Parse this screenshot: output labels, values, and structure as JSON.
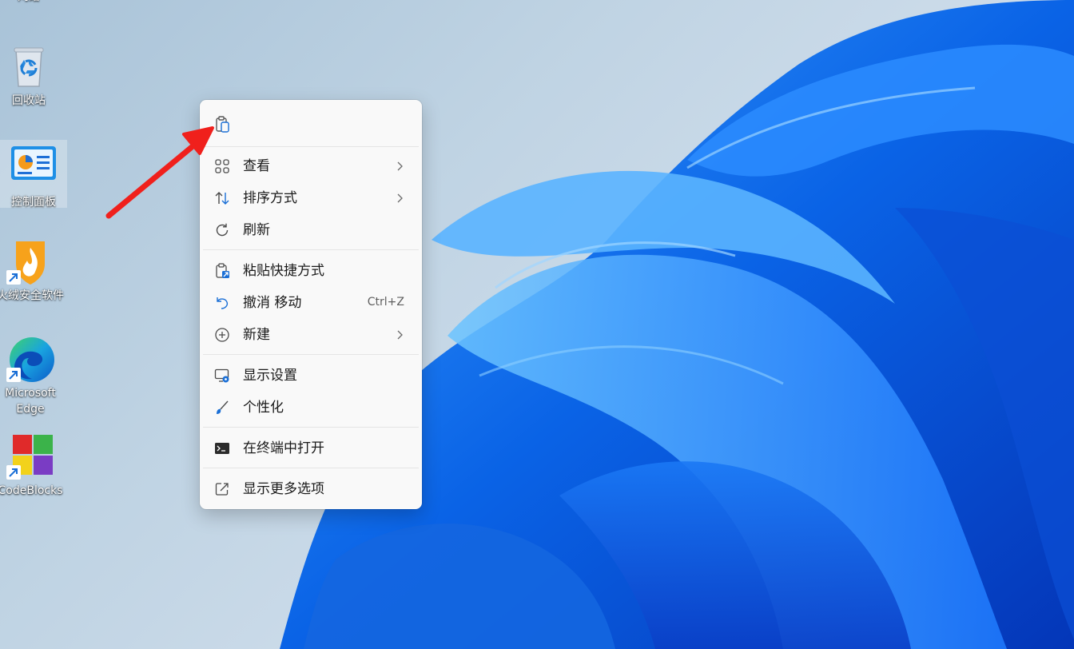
{
  "desktop": {
    "icons": [
      {
        "label": "网络"
      },
      {
        "label": "回收站"
      },
      {
        "label": "控制面板"
      },
      {
        "label": "火绒安全软件"
      },
      {
        "label_line1": "Microsoft",
        "label_line2": "Edge"
      },
      {
        "label": "CodeBlocks"
      }
    ]
  },
  "context_menu": {
    "quick_actions": [
      {
        "icon": "paste-icon"
      }
    ],
    "items": [
      {
        "icon": "view-grid-icon",
        "label": "查看",
        "submenu": true
      },
      {
        "icon": "sort-icon",
        "label": "排序方式",
        "submenu": true
      },
      {
        "icon": "refresh-icon",
        "label": "刷新"
      },
      {
        "icon": "paste-shortcut-icon",
        "label": "粘贴快捷方式"
      },
      {
        "icon": "undo-icon",
        "label": "撤消 移动",
        "shortcut": "Ctrl+Z"
      },
      {
        "icon": "new-plus-icon",
        "label": "新建",
        "submenu": true
      },
      {
        "icon": "display-settings-icon",
        "label": "显示设置"
      },
      {
        "icon": "personalize-brush-icon",
        "label": "个性化"
      },
      {
        "icon": "terminal-icon",
        "label": "在终端中打开"
      },
      {
        "icon": "show-more-options-icon",
        "label": "显示更多选项"
      }
    ]
  },
  "colors": {
    "accent": "#005fb8",
    "annotation_arrow": "#f0201c",
    "menu_background": "#f9f9f9"
  }
}
